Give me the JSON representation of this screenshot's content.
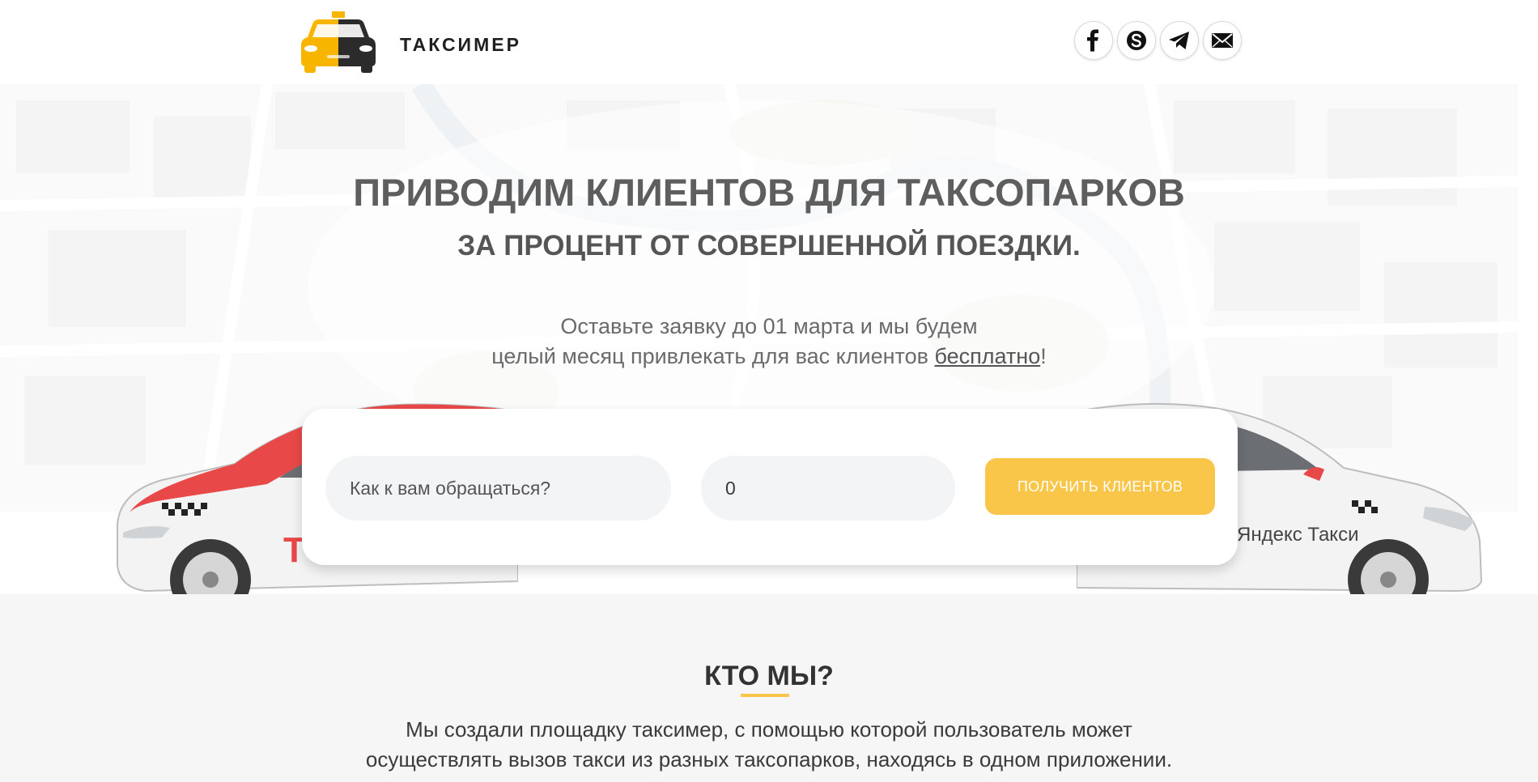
{
  "header": {
    "logo_text": "ТАКСИМЕР",
    "logo_icon": "taxi-car-icon",
    "socials": [
      {
        "name": "facebook",
        "icon": "facebook-icon"
      },
      {
        "name": "skype",
        "icon": "skype-icon"
      },
      {
        "name": "telegram",
        "icon": "telegram-icon"
      },
      {
        "name": "email",
        "icon": "mail-icon"
      }
    ]
  },
  "hero": {
    "title": "ПРИВОДИМ КЛИЕНТОВ ДЛЯ ТАКСОПАРКОВ",
    "subtitle": "ЗА ПРОЦЕНТ ОТ СОВЕРШЕННОЙ ПОЕЗДКИ.",
    "text_line1": "Оставьте заявку до 01 марта и мы будем",
    "text_line2_prefix": "целый месяц привлекать для вас клиентов ",
    "free_link": "бесплатно",
    "text_line2_suffix": "!",
    "right_car_brand": "Яндекс Такси",
    "left_car_brand": "Т"
  },
  "form": {
    "name_placeholder": "Как к вам обращаться?",
    "name_value": "",
    "phone_value": "0",
    "submit_label": "ПОЛУЧИТЬ КЛИЕНТОВ"
  },
  "about": {
    "title": "КТО МЫ?",
    "line1": "Мы создали площадку таксимер, с помощью которой пользователь может",
    "line2": "осуществлять вызов такси из разных таксопарков, находясь в одном приложении."
  },
  "colors": {
    "accent": "#f9c64a",
    "logo_yellow": "#f7b500",
    "logo_dark": "#2b2b2b",
    "car_red": "#e94848"
  }
}
